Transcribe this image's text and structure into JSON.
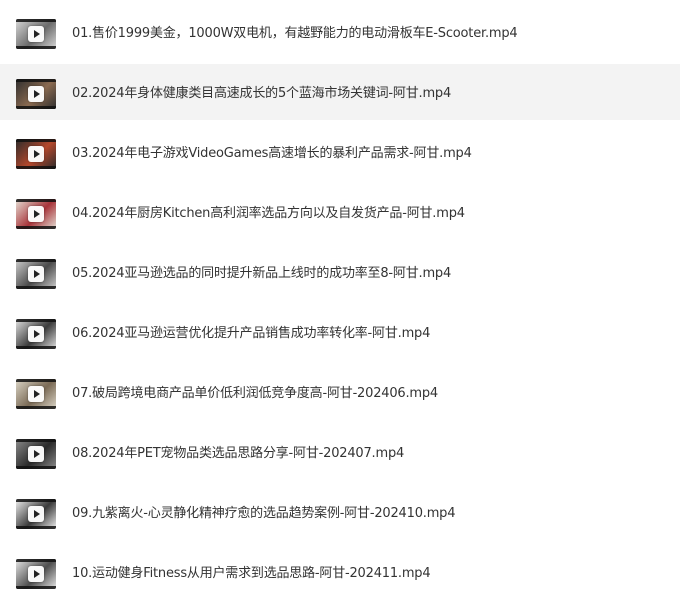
{
  "files": [
    {
      "name": "01.售价1999美金，1000W双电机，有越野能力的电动滑板车E-Scooter.mp4",
      "icon": "video-thumbnail-icon",
      "colors": [
        "#6b6b6b",
        "#d9d9d9"
      ]
    },
    {
      "name": "02.2024年身体健康类目高速成长的5个蓝海市场关键词-阿甘.mp4",
      "icon": "video-thumbnail-icon",
      "colors": [
        "#8a6a50",
        "#2e2e2e"
      ]
    },
    {
      "name": "03.2024年电子游戏VideoGames高速增长的暴利产品需求-阿甘.mp4",
      "icon": "video-thumbnail-icon",
      "colors": [
        "#b5482c",
        "#2b2b2b"
      ]
    },
    {
      "name": "04.2024年厨房Kitchen高利润率选品方向以及自发货产品-阿甘.mp4",
      "icon": "video-thumbnail-icon",
      "colors": [
        "#a8343a",
        "#e6e0d6"
      ]
    },
    {
      "name": "05.2024亚马逊选品的同时提升新品上线时的成功率至8-阿甘.mp4",
      "icon": "video-thumbnail-icon",
      "colors": [
        "#4a4a4a",
        "#cfcfcf"
      ]
    },
    {
      "name": "06.2024亚马逊运营优化提升产品销售成功率转化率-阿甘.mp4",
      "icon": "video-thumbnail-icon",
      "colors": [
        "#3b3b3b",
        "#e2e2e2"
      ]
    },
    {
      "name": "07.破局跨境电商产品单价低利润低竞争度高-阿甘-202406.mp4",
      "icon": "video-thumbnail-icon",
      "colors": [
        "#7a6a55",
        "#dcd6c8"
      ]
    },
    {
      "name": "08.2024年PET宠物品类选品思路分享-阿甘-202407.mp4",
      "icon": "video-thumbnail-icon",
      "colors": [
        "#2a2a2a",
        "#8c8c8c"
      ]
    },
    {
      "name": "09.九紫离火-心灵静化精神疗愈的选品趋势案例-阿甘-202410.mp4",
      "icon": "video-thumbnail-icon",
      "colors": [
        "#3a3a3a",
        "#f0f0f0"
      ]
    },
    {
      "name": "10.运动健身Fitness从用户需求到选品思路-阿甘-202411.mp4",
      "icon": "video-thumbnail-icon",
      "colors": [
        "#4e4e4e",
        "#e8e8e8"
      ]
    }
  ]
}
